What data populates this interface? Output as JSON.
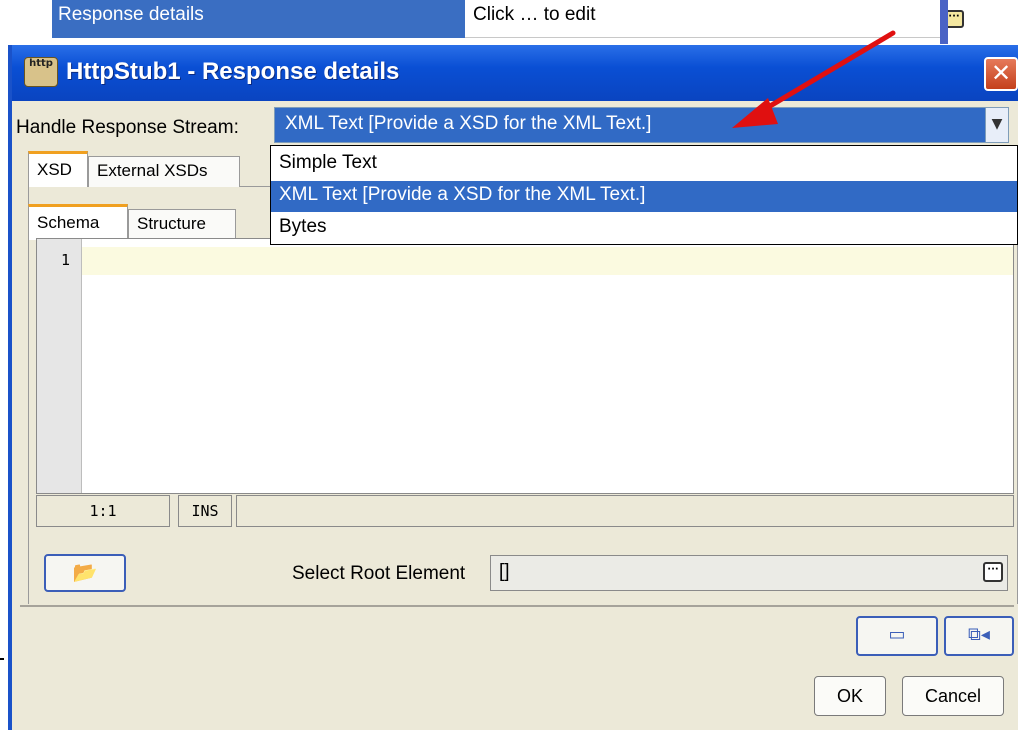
{
  "background_grid": {
    "row_label": "Response details",
    "row_value": "Click … to edit",
    "edit_button_icon": "ellipsis-icon"
  },
  "dialog": {
    "title": "HttpStub1 - Response details",
    "title_icon": "http",
    "close_glyph": "✕",
    "handle_stream": {
      "label": "Handle Response Stream:",
      "selected": "XML Text  [Provide a XSD for the XML Text.]",
      "options": [
        {
          "label": "Simple Text",
          "selected": false
        },
        {
          "label": "XML Text  [Provide a XSD for the XML Text.]",
          "selected": true
        },
        {
          "label": "Bytes",
          "selected": false
        }
      ]
    },
    "outer_tabs": [
      "XSD",
      "External XSDs"
    ],
    "inner_tabs": [
      "Schema",
      "Structure"
    ],
    "editor": {
      "line_numbers": [
        "1"
      ],
      "content": ""
    },
    "status": {
      "position": "1:1",
      "mode": "INS",
      "extra": ""
    },
    "root_element": {
      "label": "Select Root Element",
      "value": "[]"
    },
    "buttons": {
      "ok": "OK",
      "cancel": "Cancel"
    }
  },
  "colors": {
    "titlebar": "#0a4fd4",
    "selection": "#316ac5",
    "dialog_bg": "#ece9d8",
    "annotation_arrow": "#e01010",
    "active_tab_accent": "#f0a020"
  }
}
